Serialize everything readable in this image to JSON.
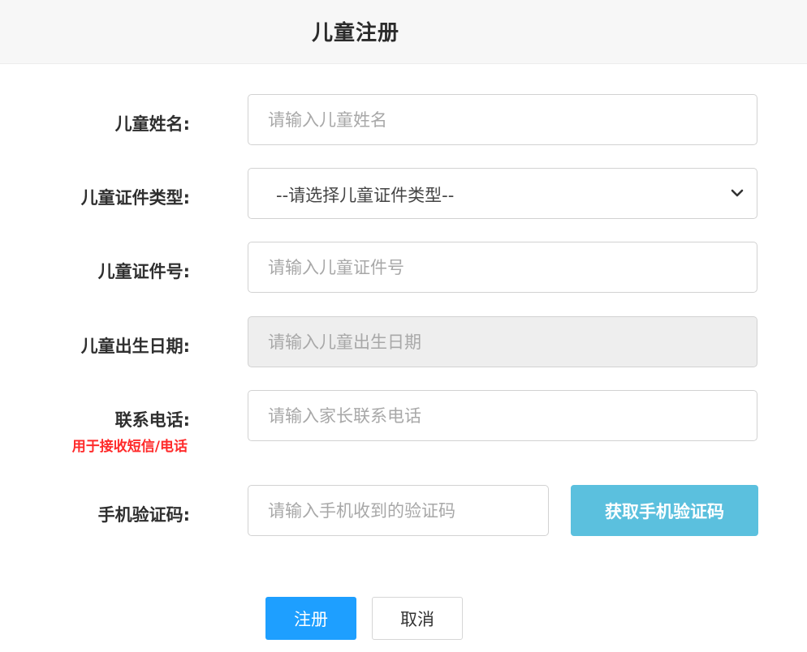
{
  "page": {
    "title": "儿童注册"
  },
  "form": {
    "name": {
      "label": "儿童姓名:",
      "placeholder": "请输入儿童姓名",
      "value": ""
    },
    "id_type": {
      "label": "儿童证件类型:",
      "selected": "--请选择儿童证件类型--",
      "icon": "chevron-down-icon"
    },
    "id_number": {
      "label": "儿童证件号:",
      "placeholder": "请输入儿童证件号",
      "value": ""
    },
    "birth_date": {
      "label": "儿童出生日期:",
      "placeholder": "请输入儿童出生日期",
      "value": "",
      "disabled": true
    },
    "phone": {
      "label": "联系电话:",
      "hint": "用于接收短信/电话",
      "hint_color": "#ff2a2a",
      "placeholder": "请输入家长联系电话",
      "value": ""
    },
    "sms_code": {
      "label": "手机验证码:",
      "placeholder": "请输入手机收到的验证码",
      "value": "",
      "button_label": "获取手机验证码",
      "button_color": "#5bc0de"
    }
  },
  "actions": {
    "register_label": "注册",
    "register_color": "#1e9fff",
    "cancel_label": "取消"
  }
}
